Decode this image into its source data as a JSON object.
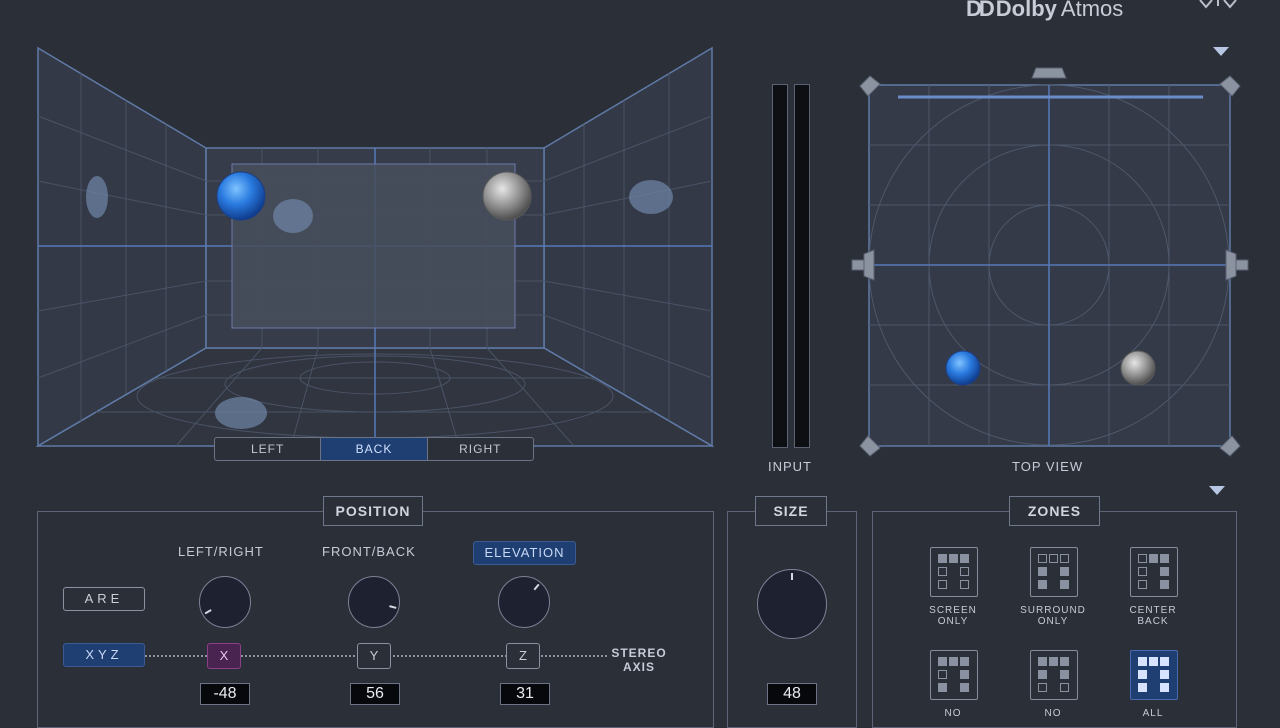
{
  "brand": {
    "logo_symbol": "DD",
    "name_bold": "Dolby",
    "name_light": "Atmos"
  },
  "room_view": {
    "segments": [
      {
        "label": "LEFT",
        "active": false
      },
      {
        "label": "BACK",
        "active": true
      },
      {
        "label": "RIGHT",
        "active": false
      }
    ]
  },
  "meters": {
    "label": "INPUT"
  },
  "top_view": {
    "label": "TOP VIEW"
  },
  "position": {
    "title": "POSITION",
    "left_right_label": "LEFT/RIGHT",
    "front_back_label": "FRONT/BACK",
    "elevation_label": "ELEVATION",
    "are_label": "ARE",
    "xyz_label": "XYZ",
    "x_label": "X",
    "y_label": "Y",
    "z_label": "Z",
    "stereo_axis_line1": "STEREO",
    "stereo_axis_line2": "AXIS",
    "x_value": "-48",
    "y_value": "56",
    "z_value": "31"
  },
  "size": {
    "title": "SIZE",
    "value": "48"
  },
  "zones": {
    "title": "ZONES",
    "items": [
      {
        "line1": "SCREEN",
        "line2": "ONLY"
      },
      {
        "line1": "SURROUND",
        "line2": "ONLY"
      },
      {
        "line1": "CENTER",
        "line2": "BACK"
      },
      {
        "line1": "NO",
        "line2": ""
      },
      {
        "line1": "NO",
        "line2": ""
      },
      {
        "line1": "ALL",
        "line2": ""
      }
    ]
  },
  "colors": {
    "accent_blue": "#1f3f73",
    "background": "#2b2f38",
    "x_axis_magenta": "#4a2450"
  }
}
